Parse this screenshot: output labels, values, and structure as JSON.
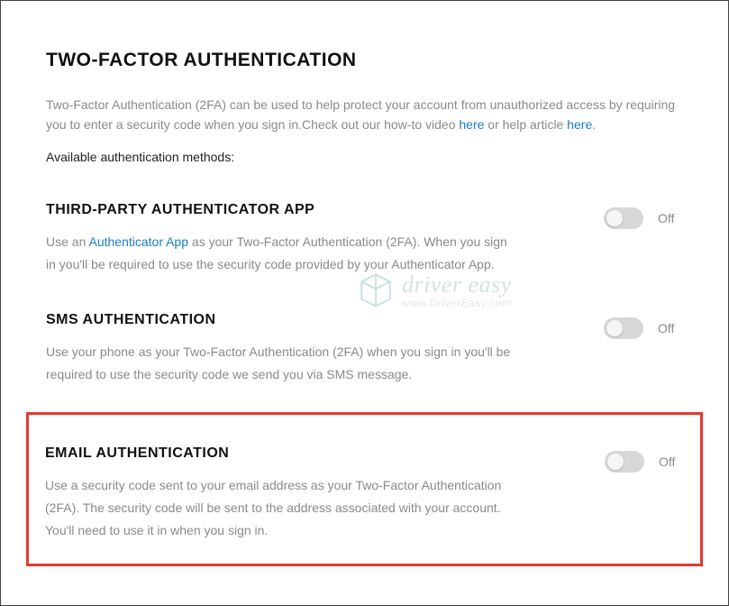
{
  "page": {
    "title": "TWO-FACTOR AUTHENTICATION",
    "intro_pre": "Two-Factor Authentication (2FA) can be used to help protect your account from unauthorized access by requiring you to enter a security code when you sign in.Check out our how-to video ",
    "intro_link1": "here",
    "intro_mid": " or help article ",
    "intro_link2": "here",
    "intro_end": ".",
    "available_label": "Available authentication methods:"
  },
  "methods": {
    "authenticator": {
      "title": "THIRD-PARTY AUTHENTICATOR APP",
      "desc_pre": "Use an ",
      "desc_link": "Authenticator App",
      "desc_post": " as your Two-Factor Authentication (2FA). When you sign in you'll be required to use the security code provided by your Authenticator App.",
      "state": "Off"
    },
    "sms": {
      "title": "SMS AUTHENTICATION",
      "desc": "Use your phone as your Two-Factor Authentication (2FA) when you sign in you'll be required to use the security code we send you via SMS message.",
      "state": "Off"
    },
    "email": {
      "title": "EMAIL AUTHENTICATION",
      "desc": "Use a security code sent to your email address as your Two-Factor Authentication (2FA). The security code will be sent to the address associated with your account. You'll need to use it in when you sign in.",
      "state": "Off"
    }
  },
  "watermark": {
    "title": "driver easy",
    "url": "www.DriverEasy.com"
  }
}
